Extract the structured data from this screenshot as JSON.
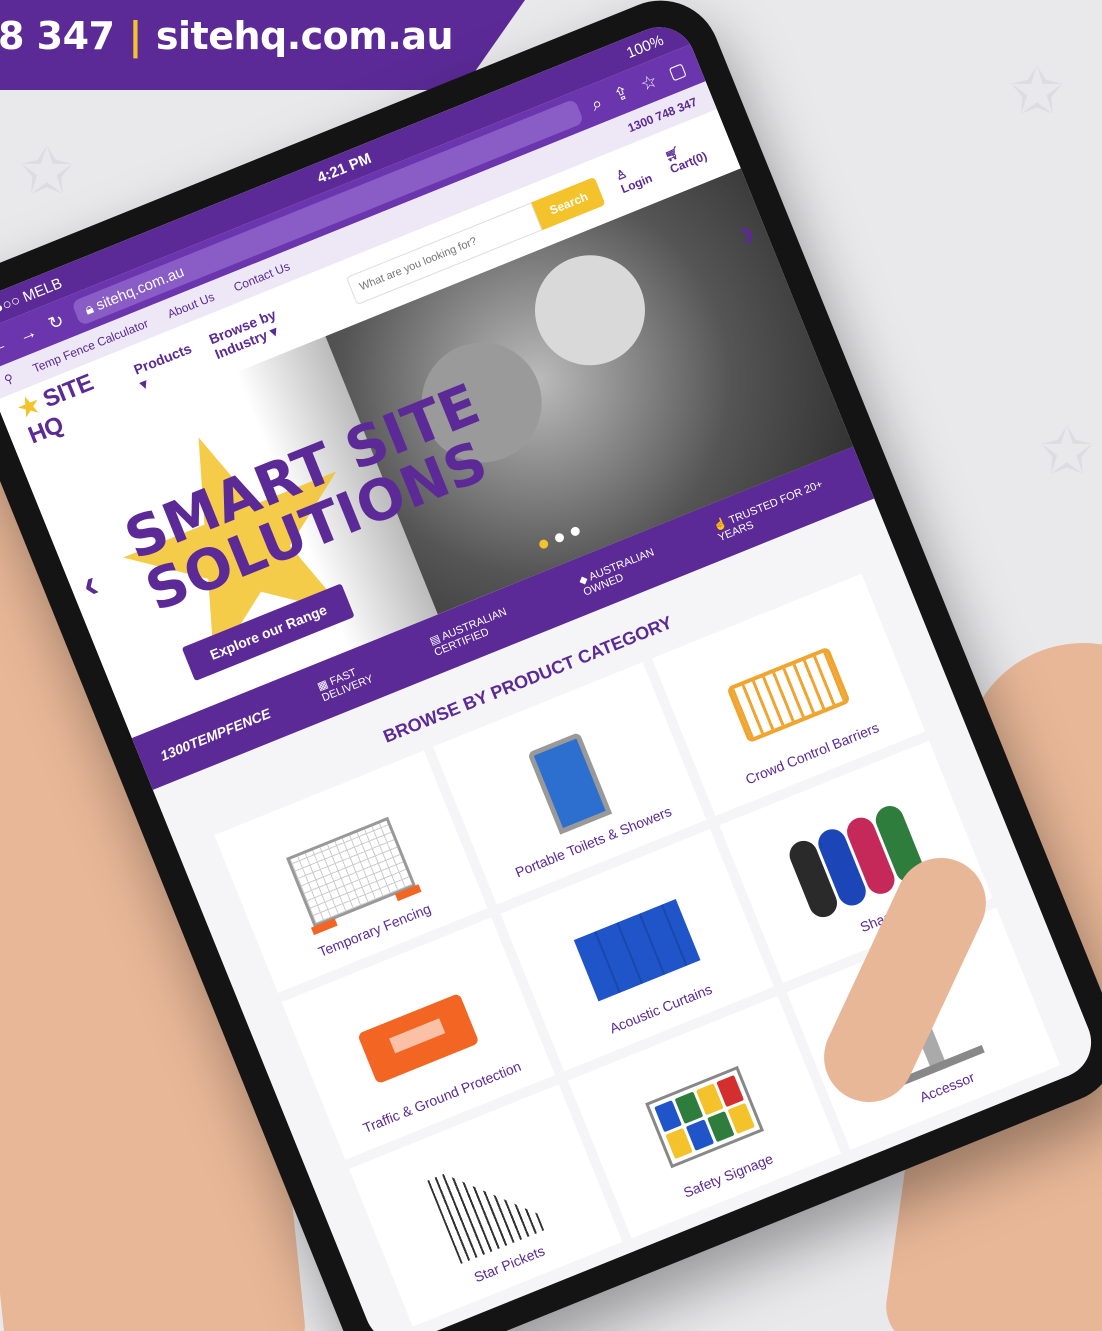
{
  "banner": {
    "phone": "8 347",
    "divider": "|",
    "url": "sitehq.com.au"
  },
  "statusbar": {
    "carrier": "●●○○ MELB",
    "time": "4:21 PM",
    "battery": "100%"
  },
  "browser": {
    "address": "sitehq.com.au"
  },
  "topnav": {
    "links": [
      "Temp Fence Calculator",
      "About Us",
      "Contact Us"
    ],
    "phone": "1300 748 347"
  },
  "header": {
    "logo_text": "SITE HQ",
    "products_label": "Products ▾",
    "industry_label": "Browse by Industry ▾",
    "search_placeholder": "What are you looking for?",
    "search_button": "Search",
    "login_label": "Login",
    "cart_label": "Cart(0)"
  },
  "hero": {
    "title_line1": "SMART SITE",
    "title_line2": "SOLUTIONS",
    "cta": "Explore our Range",
    "prev": "‹",
    "next": "›"
  },
  "trust": {
    "brand_prefix": "1300",
    "brand_suffix": "TEMPFENCE",
    "items": [
      "FAST DELIVERY",
      "AUSTRALIAN CERTIFIED",
      "AUSTRALIAN OWNED",
      "TRUSTED FOR 20+ YEARS"
    ]
  },
  "category": {
    "title": "BROWSE BY PRODUCT CATEGORY",
    "tiles": [
      {
        "label": "Temporary Fencing",
        "icon": "fence-panel"
      },
      {
        "label": "Portable Toilets & Showers",
        "icon": "portable-toilet"
      },
      {
        "label": "Crowd Control Barriers",
        "icon": "crowd-barrier"
      },
      {
        "label": "Traffic & Ground Protection",
        "icon": "traffic-barrier"
      },
      {
        "label": "Acoustic Curtains",
        "icon": "acoustic-curtain"
      },
      {
        "label": "Shade",
        "icon": "shade-cloth-rolls"
      },
      {
        "label": "Star Pickets",
        "icon": "star-pickets"
      },
      {
        "label": "Safety Signage",
        "icon": "safety-sign-board"
      },
      {
        "label": "Accessor",
        "icon": "fence-accessory"
      }
    ]
  },
  "colors": {
    "brand_purple": "#5b2a97",
    "brand_yellow": "#f4c22b",
    "orange": "#f26522",
    "blue": "#1f55c9"
  }
}
